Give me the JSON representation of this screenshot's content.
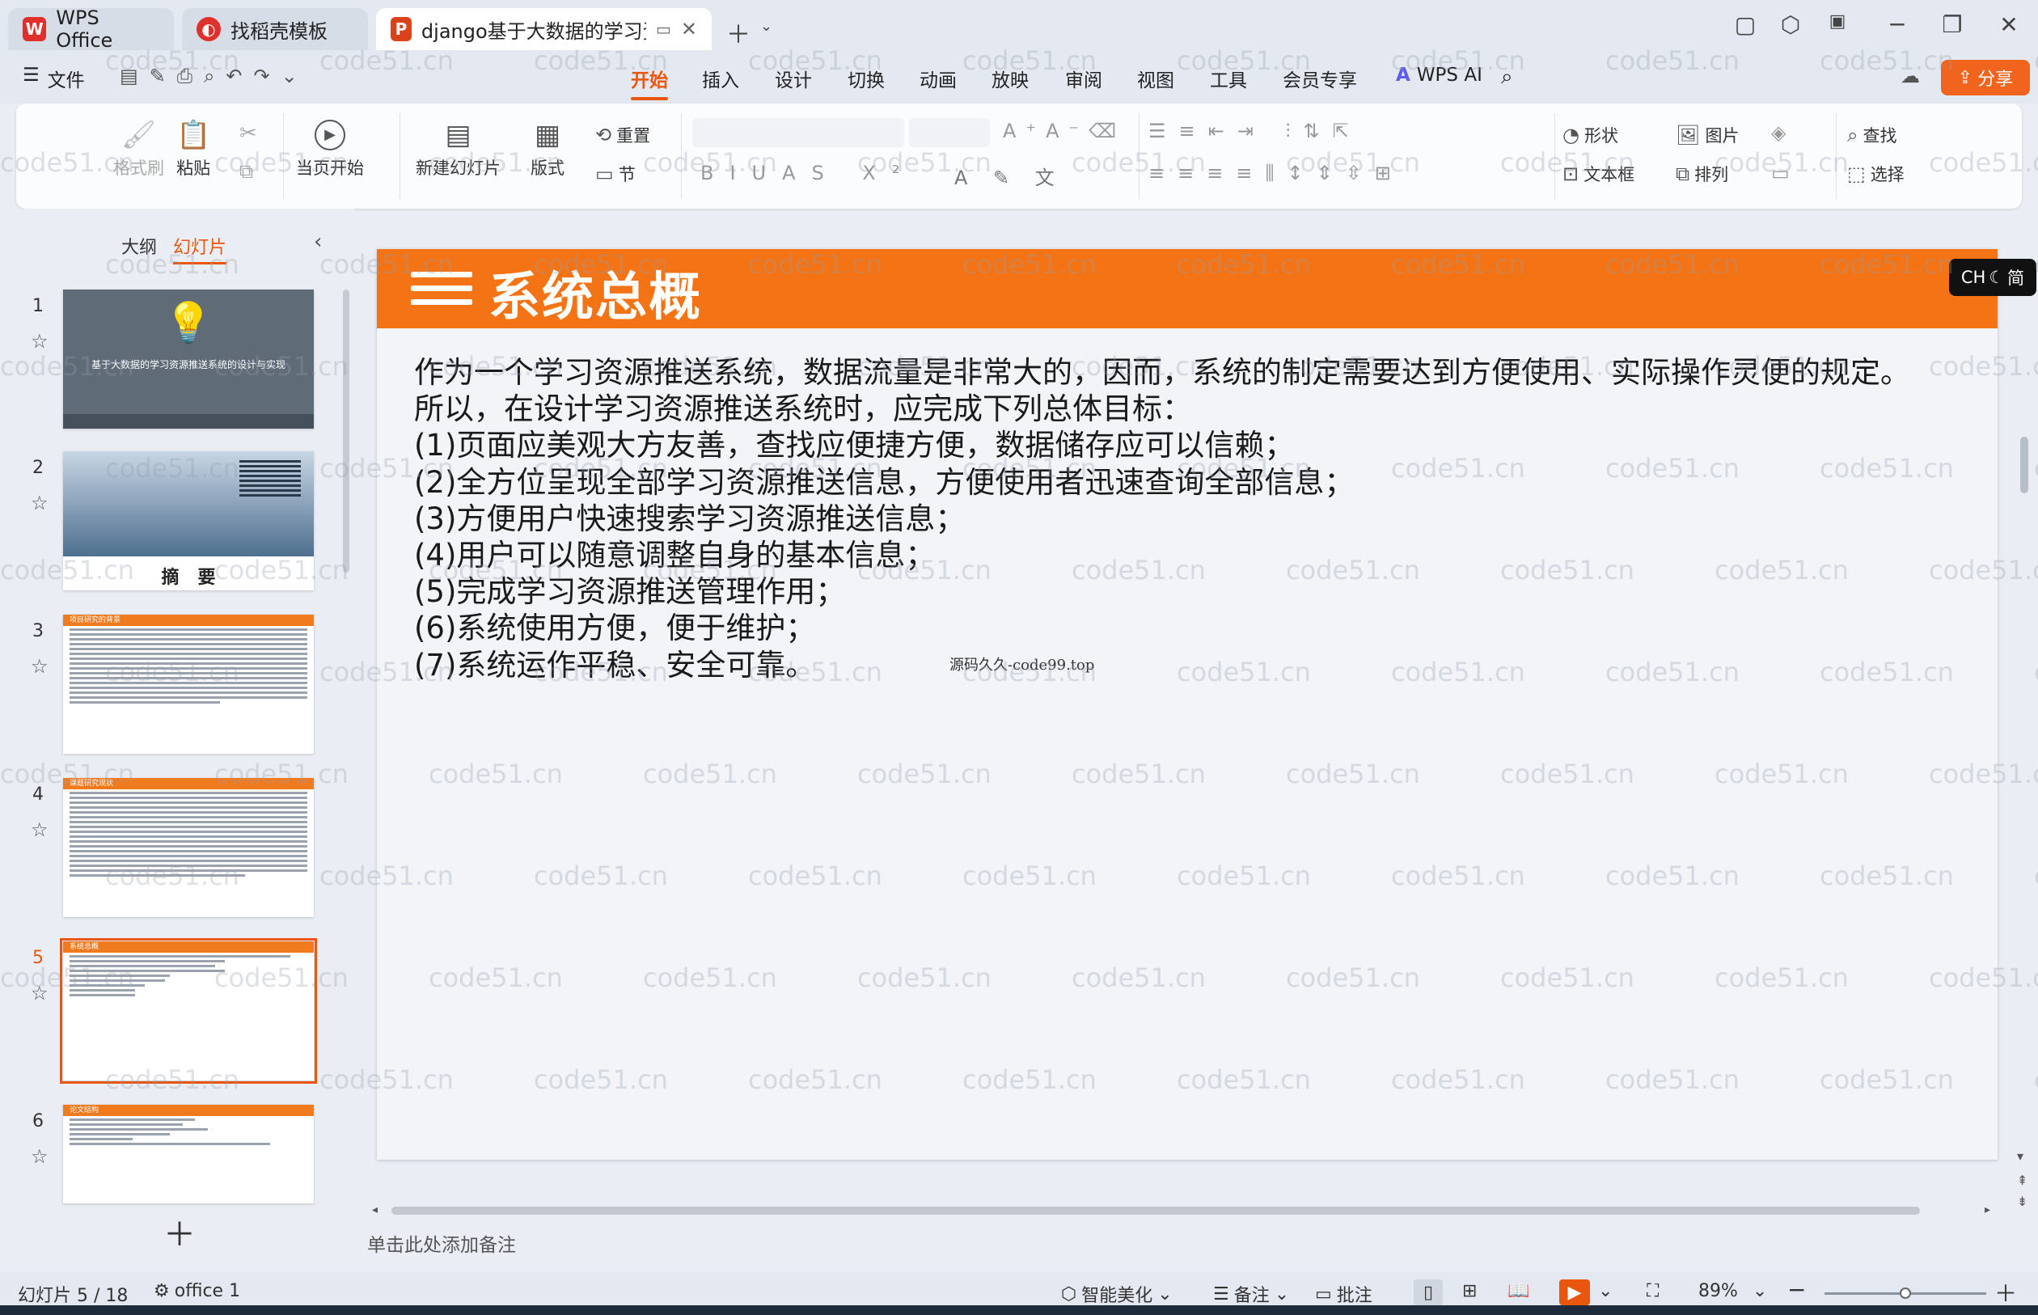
{
  "tabs": {
    "wps_label": "WPS Office",
    "template_label": "找稻壳模板",
    "doc_label": "django基于大数据的学习资源"
  },
  "menu": {
    "file": "文件",
    "items": [
      "开始",
      "插入",
      "设计",
      "切换",
      "动画",
      "放映",
      "审阅",
      "视图",
      "工具",
      "会员专享"
    ],
    "active": "开始",
    "wps_ai": "WPS AI",
    "share": "分享"
  },
  "ribbon": {
    "format_painter": "格式刷",
    "paste": "粘贴",
    "from_current": "当页开始",
    "new_slide": "新建幻灯片",
    "layout": "版式",
    "reset": "重置",
    "section": "节",
    "shape": "形状",
    "picture": "图片",
    "find": "查找",
    "textbox": "文本框",
    "arrange": "排列",
    "select": "选择"
  },
  "left_pane": {
    "outline_tab": "大纲",
    "slides_tab": "幻灯片",
    "thumb1_caption": "基于大数据的学习资源推送系统的设计与实现",
    "thumb2_caption": "摘   要",
    "thumb3_header": "项目研究的背景",
    "thumb4_header": "课题研究现状",
    "thumb5_header": "系统总概",
    "thumb6_header": "论文结构",
    "slide_numbers": [
      "1",
      "2",
      "3",
      "4",
      "5",
      "6"
    ],
    "active_slide": "5"
  },
  "slide": {
    "title": "系统总概",
    "lines": [
      "作为一个学习资源推送系统，数据流量是非常大的，因而，系统的制定需要达到方便使用、实际操作灵便的规定。",
      "所以，在设计学习资源推送系统时，应完成下列总体目标：",
      "(1)页面应美观大方友善，查找应便捷方便，数据储存应可以信赖；",
      "(2)全方位呈现全部学习资源推送信息，方便使用者迅速查询全部信息；",
      "(3)方便用户快速搜索学习资源推送信息；",
      "(4)用户可以随意调整自身的基本信息；",
      "(5)完成学习资源推送管理作用；",
      "(6)系统使用方便，便于维护；",
      "(7)系统运作平稳、安全可靠。"
    ],
    "footnote": "源码久久-code99.top"
  },
  "watermark": "code51.cn",
  "ime": "CH",
  "ime_mode": "简",
  "notes_placeholder": "单击此处添加备注",
  "status": {
    "slide_counter": "幻灯片 5 / 18",
    "theme": "office 1",
    "beautify": "智能美化",
    "notes": "备注",
    "comments": "批注",
    "zoom": "89%",
    "zoom_fraction": 0.5
  },
  "colors": {
    "accent": "#e8560f",
    "slide_header": "#f47314",
    "share_button": "#f0641e"
  }
}
